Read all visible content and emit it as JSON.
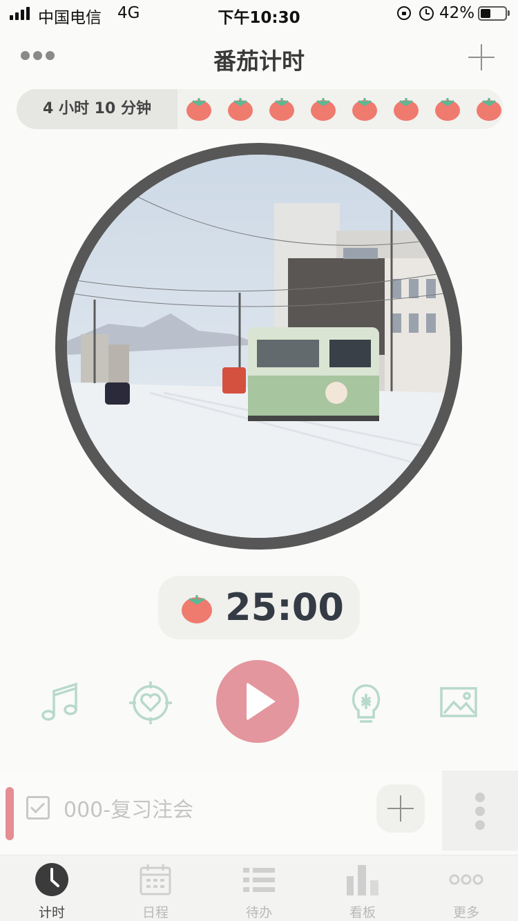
{
  "status_bar": {
    "carrier": "中国电信",
    "network": "4G",
    "time": "下午10:30",
    "battery_percent": "42%",
    "battery_level": 0.42,
    "icons": [
      "signal-icon",
      "orientation-lock-icon",
      "alarm-icon",
      "battery-icon"
    ]
  },
  "header": {
    "title": "番茄计时",
    "left_icon": "more-dots-icon",
    "right_icon": "plus-icon"
  },
  "summary": {
    "total_time": "4 小时  10 分钟",
    "tomato_count_visible": 8
  },
  "focus_image": {
    "description_icon": "background-photo"
  },
  "timer": {
    "value": "25:00",
    "icon": "tomato-icon"
  },
  "controls": [
    {
      "name": "music-icon",
      "color": "#b7d9cc"
    },
    {
      "name": "target-heart-icon",
      "color": "#b7d9cc"
    },
    {
      "name": "play-icon",
      "color": "#e3969d"
    },
    {
      "name": "lightbulb-icon",
      "color": "#b7d9cc"
    },
    {
      "name": "image-icon",
      "color": "#b7d9cc"
    }
  ],
  "task": {
    "label": "000-复习注会",
    "accent_color": "#e58d93"
  },
  "tabs": [
    {
      "label": "计时",
      "icon": "clock-icon",
      "active": true
    },
    {
      "label": "日程",
      "icon": "calendar-icon",
      "active": false
    },
    {
      "label": "待办",
      "icon": "list-icon",
      "active": false
    },
    {
      "label": "看板",
      "icon": "bar-chart-icon",
      "active": false
    },
    {
      "label": "更多",
      "icon": "more-dots-icon",
      "active": false
    }
  ],
  "colors": {
    "accent_pink": "#e3969d",
    "tomato_red": "#ef7a6e",
    "tomato_leaf": "#5cb894",
    "icon_mint": "#b7d9cc"
  }
}
